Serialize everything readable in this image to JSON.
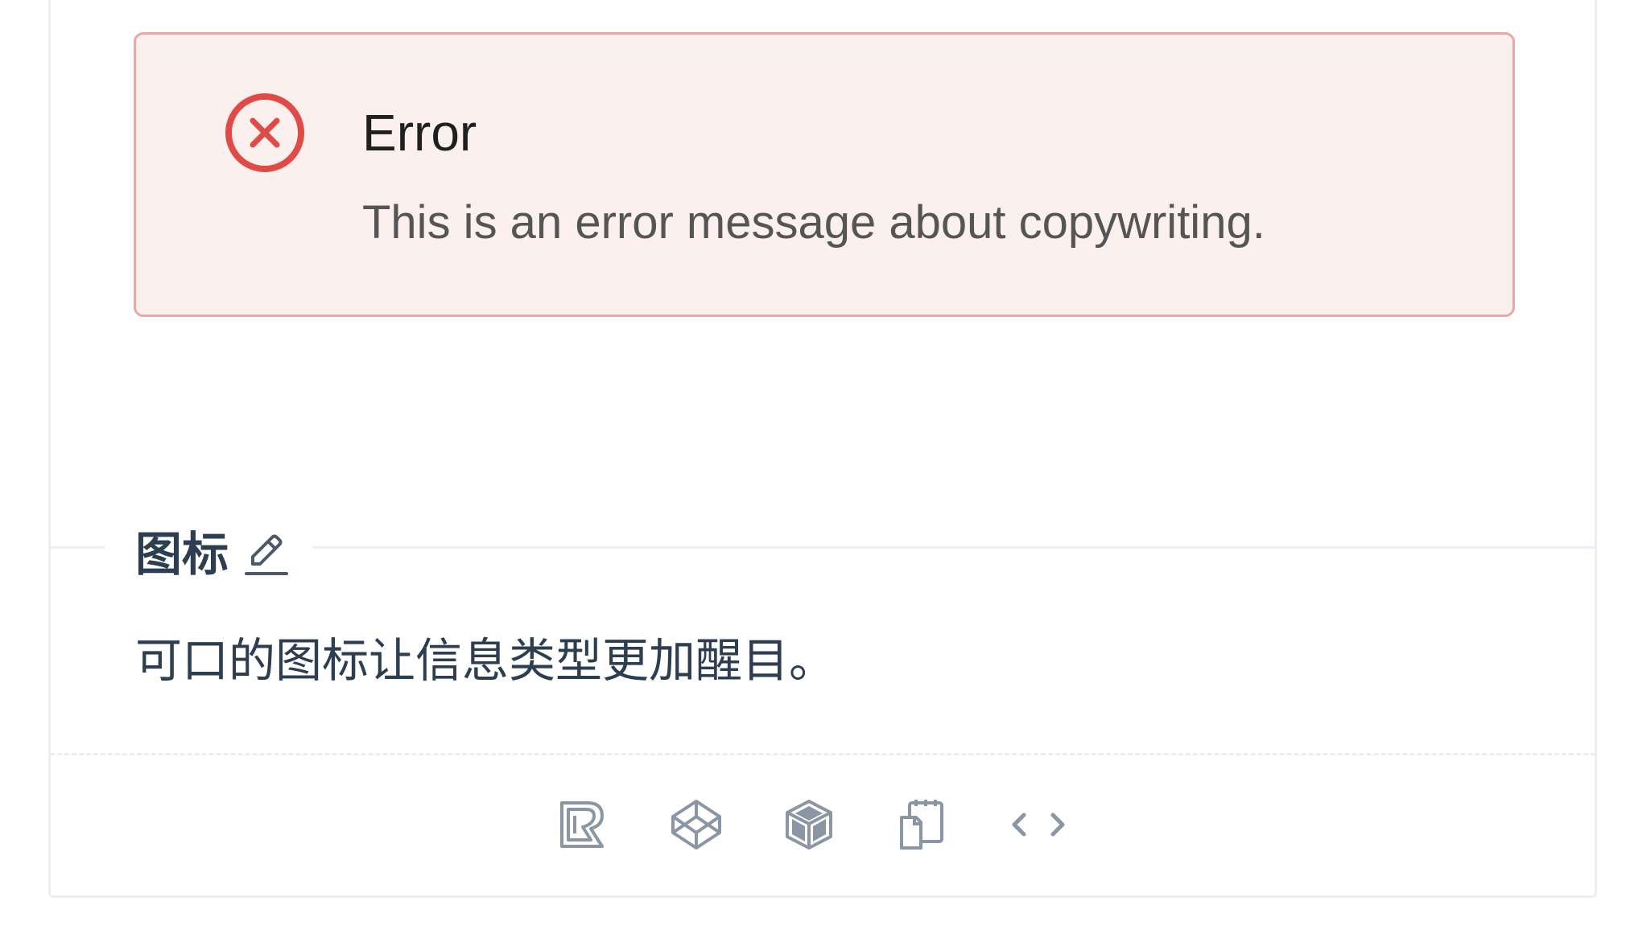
{
  "alert": {
    "type": "error",
    "icon": "close-circle-icon",
    "title": "Error",
    "description": "This is an error message about copywriting.",
    "color_accent": "#e04b47",
    "color_background": "#fcf0ef",
    "color_border": "#eca6a4"
  },
  "section": {
    "title": "图标",
    "edit_icon": "edit-icon",
    "description": "可口的图标让信息类型更加醒目。"
  },
  "actions": [
    {
      "name": "riddle-icon"
    },
    {
      "name": "codepen-icon"
    },
    {
      "name": "codesandbox-icon"
    },
    {
      "name": "copy-icon"
    },
    {
      "name": "code-icon"
    }
  ]
}
